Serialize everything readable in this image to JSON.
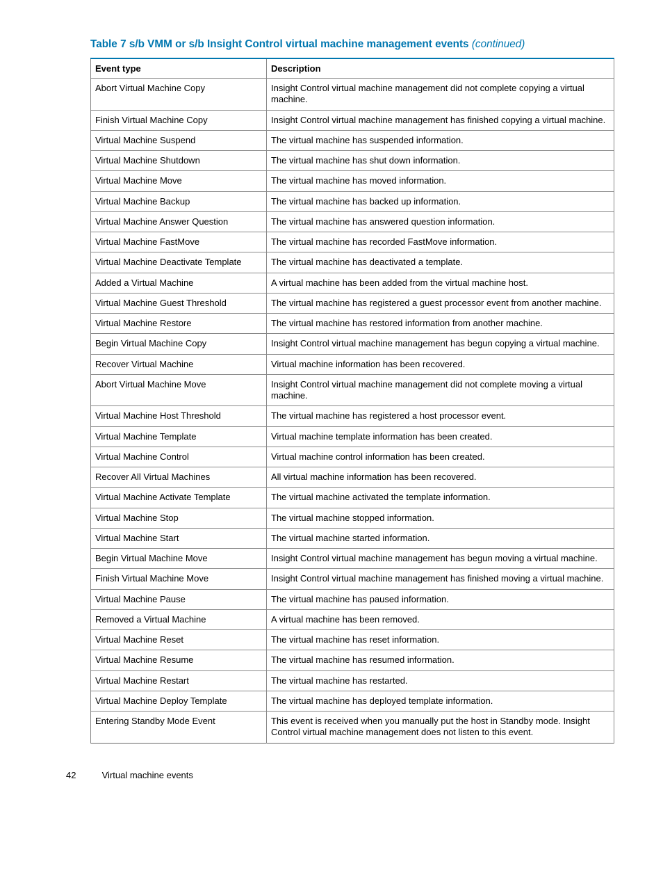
{
  "title_main": "Table 7 s/b VMM or s/b Insight Control virtual machine management events ",
  "title_cont": "(continued)",
  "headers": {
    "col1": "Event type",
    "col2": "Description"
  },
  "rows": [
    {
      "event": "Abort Virtual Machine Copy",
      "desc": "Insight Control virtual machine management did not complete copying a virtual machine."
    },
    {
      "event": "Finish Virtual Machine Copy",
      "desc": "Insight Control virtual machine management has finished copying a virtual machine."
    },
    {
      "event": "Virtual Machine Suspend",
      "desc": "The virtual machine has suspended information."
    },
    {
      "event": "Virtual Machine Shutdown",
      "desc": "The virtual machine has shut down information."
    },
    {
      "event": "Virtual Machine Move",
      "desc": "The virtual machine has moved information."
    },
    {
      "event": "Virtual Machine Backup",
      "desc": "The virtual machine has backed up information."
    },
    {
      "event": "Virtual Machine Answer Question",
      "desc": "The virtual machine has answered question information."
    },
    {
      "event": "Virtual Machine FastMove",
      "desc": "The virtual machine has recorded FastMove information."
    },
    {
      "event": "Virtual Machine Deactivate Template",
      "desc": "The virtual machine has deactivated a template."
    },
    {
      "event": "Added a Virtual Machine",
      "desc": "A virtual machine has been added from the virtual machine host."
    },
    {
      "event": "Virtual Machine Guest Threshold",
      "desc": "The virtual machine has registered a guest processor event from another machine."
    },
    {
      "event": "Virtual Machine Restore",
      "desc": "The virtual machine has restored information from another machine."
    },
    {
      "event": "Begin Virtual Machine Copy",
      "desc": "Insight Control virtual machine management has begun copying a virtual machine."
    },
    {
      "event": "Recover Virtual Machine",
      "desc": "Virtual machine information has been recovered."
    },
    {
      "event": "Abort Virtual Machine Move",
      "desc": "Insight Control virtual machine management did not complete moving a virtual machine."
    },
    {
      "event": "Virtual Machine Host Threshold",
      "desc": "The virtual machine has registered a host processor event."
    },
    {
      "event": "Virtual Machine Template",
      "desc": "Virtual machine template information has been created."
    },
    {
      "event": "Virtual Machine Control",
      "desc": "Virtual machine control information has been created."
    },
    {
      "event": "Recover All Virtual Machines",
      "desc": "All virtual machine information has been recovered."
    },
    {
      "event": "Virtual Machine Activate Template",
      "desc": "The virtual machine activated the template information."
    },
    {
      "event": "Virtual Machine Stop",
      "desc": "The virtual machine stopped information."
    },
    {
      "event": "Virtual Machine Start",
      "desc": "The virtual machine started information."
    },
    {
      "event": "Begin Virtual Machine Move",
      "desc": "Insight Control virtual machine management has begun moving a virtual machine."
    },
    {
      "event": "Finish Virtual Machine Move",
      "desc": "Insight Control virtual machine management has finished moving a virtual machine."
    },
    {
      "event": "Virtual Machine Pause",
      "desc": "The virtual machine has paused information."
    },
    {
      "event": "Removed a Virtual Machine",
      "desc": "A virtual machine has been removed."
    },
    {
      "event": "Virtual Machine Reset",
      "desc": "The virtual machine has reset information."
    },
    {
      "event": "Virtual Machine Resume",
      "desc": "The virtual machine has resumed information."
    },
    {
      "event": "Virtual Machine Restart",
      "desc": "The virtual machine has restarted."
    },
    {
      "event": "Virtual Machine Deploy Template",
      "desc": "The virtual machine has deployed template information."
    },
    {
      "event": "Entering Standby Mode Event",
      "desc": "This event is received when you manually put the host in Standby mode. Insight Control virtual machine management does not listen to this event."
    }
  ],
  "footer": {
    "page": "42",
    "section": "Virtual machine events"
  }
}
